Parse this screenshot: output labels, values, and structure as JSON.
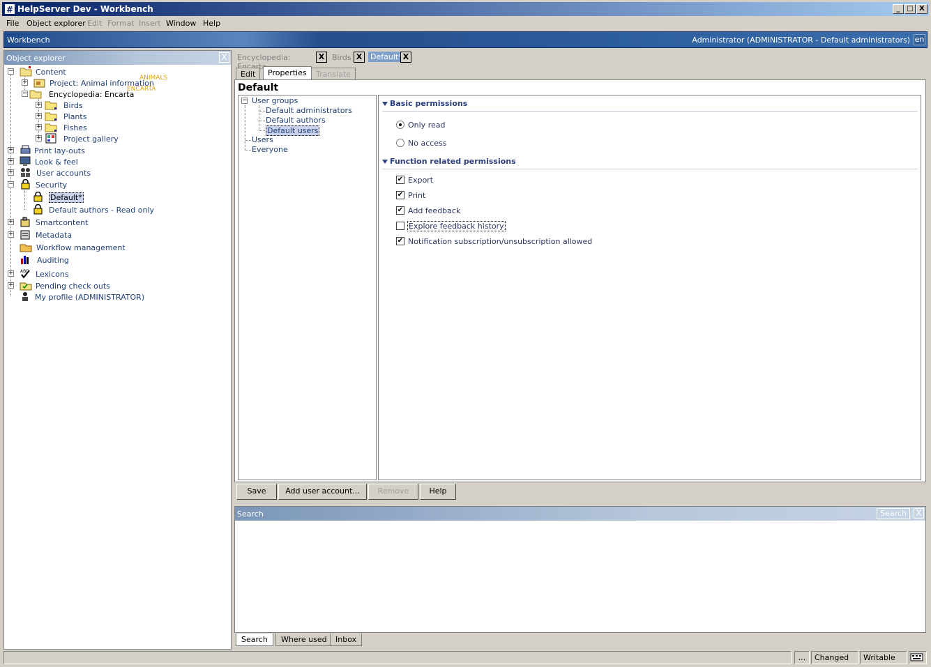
{
  "window": {
    "title": "HelpServer Dev - Workbench",
    "controls": {
      "minimize": "_",
      "maximize": "□",
      "close": "X"
    }
  },
  "menu": {
    "items": [
      {
        "label": "File",
        "enabled": true
      },
      {
        "label": "Object explorer",
        "enabled": true
      },
      {
        "label": "Edit",
        "enabled": false
      },
      {
        "label": "Format",
        "enabled": false
      },
      {
        "label": "Insert",
        "enabled": false
      },
      {
        "label": "Window",
        "enabled": true
      },
      {
        "label": "Help",
        "enabled": true
      }
    ]
  },
  "banner": {
    "title": "Workbench",
    "user": "Administrator (ADMINISTRATOR - Default administrators)",
    "language": "en"
  },
  "object_explorer": {
    "title": "Object explorer",
    "close": "X",
    "tree": {
      "content": "Content",
      "project_animal": "Project: Animal information",
      "project_animal_tag": "ANIMALS",
      "encyclopedia": "Encyclopedia: Encarta",
      "encyclopedia_tag": "ENCARTA",
      "birds": "Birds",
      "plants": "Plants",
      "fishes": "Fishes",
      "project_gallery": "Project gallery",
      "print_layouts": "Print lay-outs",
      "look_feel": "Look & feel",
      "user_accounts": "User accounts",
      "security": "Security",
      "default": "Default*",
      "default_authors_ro": "Default authors - Read only",
      "smartcontent": "Smartcontent",
      "metadata": "Metadata",
      "workflow": "Workflow management",
      "auditing": "Auditing",
      "lexicons": "Lexicons",
      "pending": "Pending check outs",
      "my_profile": "My profile (ADMINISTRATOR)"
    }
  },
  "doc_tabs": [
    {
      "label": "Encyclopedia: Encarta",
      "close": "X",
      "active": false
    },
    {
      "label": "Birds",
      "close": "X",
      "active": false
    },
    {
      "label": "Default*",
      "close": "X",
      "active": true
    }
  ],
  "sub_tabs": [
    {
      "label": "Edit",
      "active": false,
      "enabled": true
    },
    {
      "label": "Properties",
      "active": true,
      "enabled": true
    },
    {
      "label": "Translate",
      "active": false,
      "enabled": false
    }
  ],
  "page": {
    "title": "Default"
  },
  "group_tree": {
    "user_groups": "User groups",
    "default_administrators": "Default administrators",
    "default_authors": "Default authors",
    "default_users": "Default users",
    "users": "Users",
    "everyone": "Everyone"
  },
  "permissions": {
    "basic_title": "Basic permissions",
    "basic_options": [
      {
        "label": "Only read",
        "selected": true
      },
      {
        "label": "No access",
        "selected": false
      }
    ],
    "function_title": "Function related permissions",
    "function_options": [
      {
        "label": "Export",
        "checked": true
      },
      {
        "label": "Print",
        "checked": true
      },
      {
        "label": "Add feedback",
        "checked": true
      },
      {
        "label": "Explore feedback history",
        "checked": false
      },
      {
        "label": "Notification subscription/unsubscription allowed",
        "checked": true
      }
    ]
  },
  "buttons": {
    "save": "Save",
    "add_user": "Add user account...",
    "remove": "Remove",
    "help": "Help"
  },
  "search_panel": {
    "title": "Search",
    "search_button": "Search",
    "close": "X",
    "tabs": [
      "Search",
      "Where used",
      "Inbox"
    ]
  },
  "statusbar": {
    "ellipsis": "...",
    "changed": "Changed",
    "writable": "Writable"
  },
  "colors": {
    "titlebar_start": "#0a246a",
    "link_text": "#1f3f78",
    "tag_yellow": "#e0a400",
    "section_title": "#2b3f7a"
  }
}
